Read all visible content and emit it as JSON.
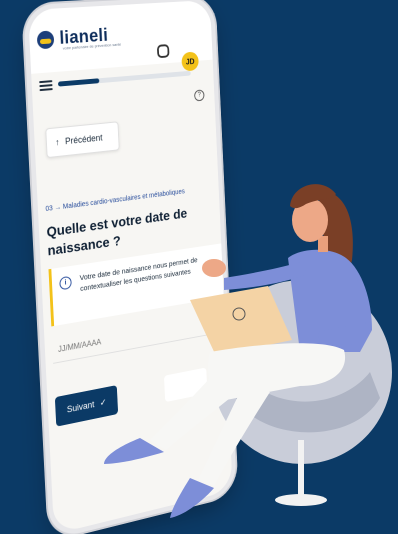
{
  "brand": {
    "name": "lianeli",
    "tagline": "votre partenaire de prévention santé"
  },
  "header": {
    "avatar_initials": "JD"
  },
  "progress": {
    "value": 0.3
  },
  "nav": {
    "prev_label": "Précédent",
    "next_label": "Suivant"
  },
  "question": {
    "breadcrumb": "03 → Maladies cardio-vasculaires et métaboliques",
    "title": "Quelle est votre date de naissance ?",
    "info_text": "Votre date de naissance nous permet de contextualiser les questions suivantes",
    "placeholder": "JJ/MM/AAAA"
  },
  "colors": {
    "background": "#0b3a66",
    "accent": "#f3c21a",
    "primary": "#0b3a66"
  }
}
